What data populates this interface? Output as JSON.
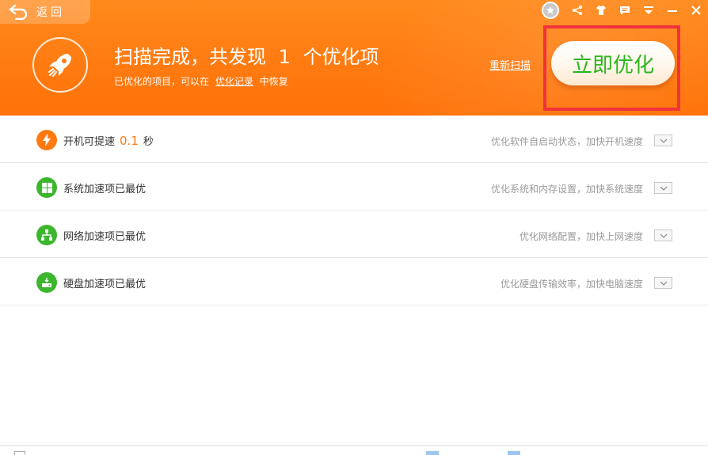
{
  "header": {
    "back_label": "返回",
    "title_prefix": "扫描完成，共发现",
    "title_count": "1",
    "title_suffix": "个优化项",
    "sub_prefix": "已优化的项目，可以在",
    "sub_link": "优化记录",
    "sub_suffix": "中恢复",
    "rescan_label": "重新扫描",
    "optimize_label": "立即优化"
  },
  "titlebar_icons": [
    "share-icon",
    "skin-icon",
    "message-icon",
    "menu-icon",
    "minimize-icon",
    "close-icon"
  ],
  "rows": [
    {
      "label": "开机可提速",
      "value": "0.1",
      "unit": "秒",
      "desc": "优化软件自启动状态，加快开机速度",
      "icon": "lightning-icon",
      "color": "#ff7a10"
    },
    {
      "label": "系统加速项已最优",
      "desc": "优化系统和内存设置，加快系统速度",
      "icon": "windows-icon",
      "color": "#3cb62d"
    },
    {
      "label": "网络加速项已最优",
      "desc": "优化网络配置，加快上网速度",
      "icon": "network-icon",
      "color": "#3cb62d"
    },
    {
      "label": "硬盘加速项已最优",
      "desc": "优化硬盘传输效率，加快电脑速度",
      "icon": "harddisk-icon",
      "color": "#3cb62d"
    }
  ],
  "colors": {
    "accent": "#ff7a10",
    "green": "#3cb62d",
    "highlight": "#f0323c"
  }
}
